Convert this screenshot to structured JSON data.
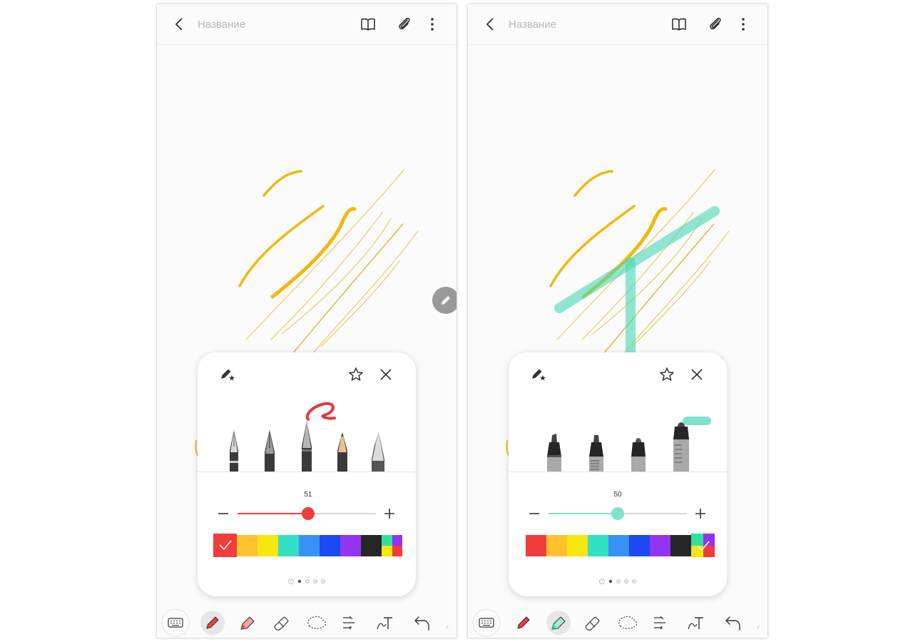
{
  "screens": [
    {
      "id": "left",
      "title_placeholder": "Название",
      "active_tool": "pen",
      "pen_size": "51",
      "size_fraction": 0.51,
      "selected_color": "#f23b3b",
      "colors": [
        "#f23b3b",
        "#ffc12e",
        "#f6e711",
        "#32e0c4",
        "#3791f7",
        "#1d48f2",
        "#9334f0",
        "#262626"
      ]
    },
    {
      "id": "right",
      "title_placeholder": "Название",
      "active_tool": "highlighter",
      "pen_size": "50",
      "size_fraction": 0.5,
      "selected_color": "#7de3cc",
      "colors": [
        "#f23b3b",
        "#ffc12e",
        "#f6e711",
        "#32e0c4",
        "#3791f7",
        "#1d48f2",
        "#9334f0",
        "#262626"
      ]
    }
  ],
  "icons": {
    "back": "chevron-left-icon",
    "book": "book-icon",
    "attach": "paperclip-icon",
    "more": "more-vertical-icon",
    "pen_favorite": "pen-star-icon",
    "favorite": "star-icon",
    "close": "close-icon",
    "keyboard": "keyboard-icon",
    "pen": "pen-icon",
    "highlighter": "highlighter-icon",
    "eraser": "eraser-icon",
    "lasso": "lasso-icon",
    "convert": "text-convert-icon",
    "handwriting": "handwriting-icon",
    "undo": "undo-icon"
  },
  "accent": {
    "pen_red": "#f23b3b",
    "highlight_mint": "#7de3cc",
    "stroke_yellow": "#efb90f"
  }
}
